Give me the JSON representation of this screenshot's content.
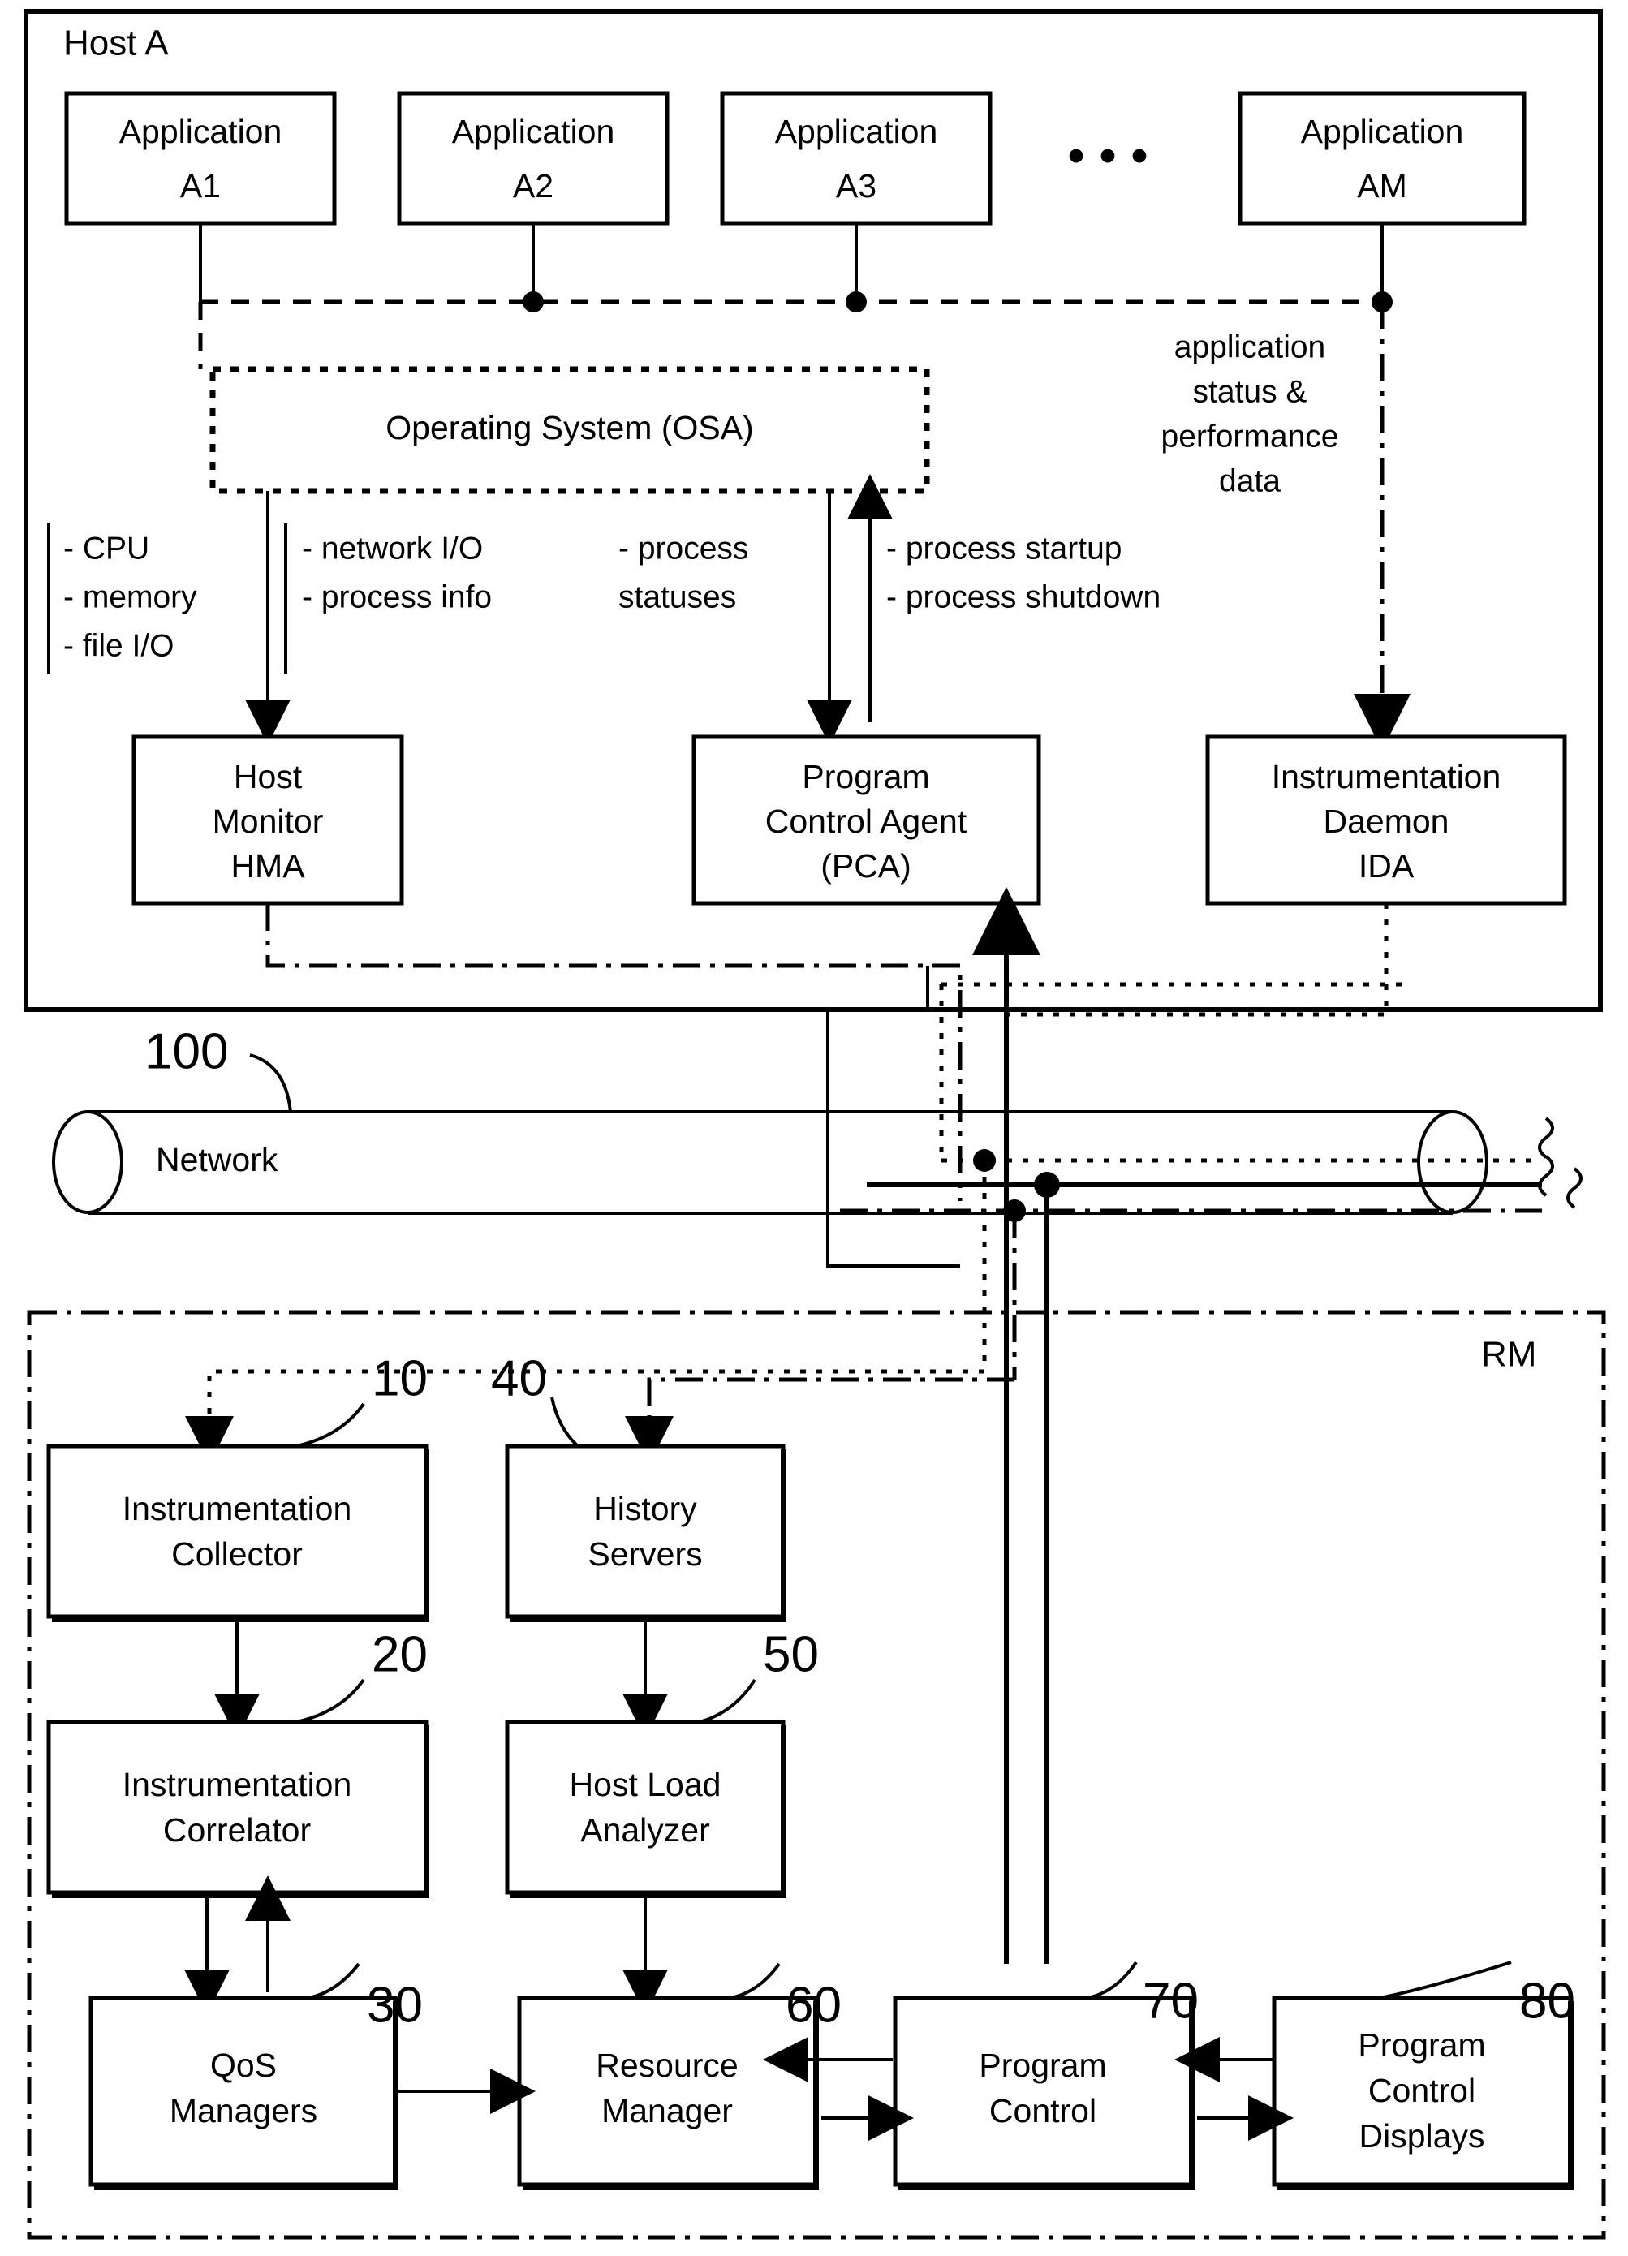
{
  "figure": {
    "host": {
      "label": "Host A"
    },
    "rm": {
      "label": "RM"
    },
    "network": {
      "label": "Network",
      "ref": "100"
    },
    "applications": [
      {
        "line1": "Application",
        "line2": "A1"
      },
      {
        "line1": "Application",
        "line2": "A2"
      },
      {
        "line1": "Application",
        "line2": "A3"
      },
      {
        "line1": "Application",
        "line2": "AM"
      }
    ],
    "ellipsis": "• • •",
    "os": {
      "label": "Operating System (OSA)"
    },
    "annotations": {
      "group1": [
        "- CPU",
        "- memory",
        "- file I/O"
      ],
      "group2": [
        "- network I/O",
        "- process info"
      ],
      "group3": [
        "- process",
        "  statuses"
      ],
      "group4": [
        "- process startup",
        "- process shutdown"
      ],
      "group5": [
        "application",
        "status &",
        "performance",
        "data"
      ]
    },
    "agents": [
      {
        "lines": [
          "Host",
          "Monitor",
          "HMA"
        ]
      },
      {
        "lines": [
          "Program",
          "Control Agent",
          "(PCA)"
        ]
      },
      {
        "lines": [
          "Instrumentation",
          "Daemon",
          "IDA"
        ]
      }
    ],
    "rm_blocks": [
      {
        "ref": "10",
        "lines": [
          "Instrumentation",
          "Collector"
        ]
      },
      {
        "ref": "40",
        "lines": [
          "History",
          "Servers"
        ]
      },
      {
        "ref": "20",
        "lines": [
          "Instrumentation",
          "Correlator"
        ]
      },
      {
        "ref": "50",
        "lines": [
          "Host Load",
          "Analyzer"
        ]
      },
      {
        "ref": "30",
        "lines": [
          "QoS",
          "Managers"
        ]
      },
      {
        "ref": "60",
        "lines": [
          "Resource",
          "Manager"
        ]
      },
      {
        "ref": "70",
        "lines": [
          "Program",
          "Control"
        ]
      },
      {
        "ref": "80",
        "lines": [
          "Program",
          "Control",
          "Displays"
        ]
      }
    ],
    "colors": {
      "ink": "#000000",
      "paper": "#ffffff"
    }
  }
}
